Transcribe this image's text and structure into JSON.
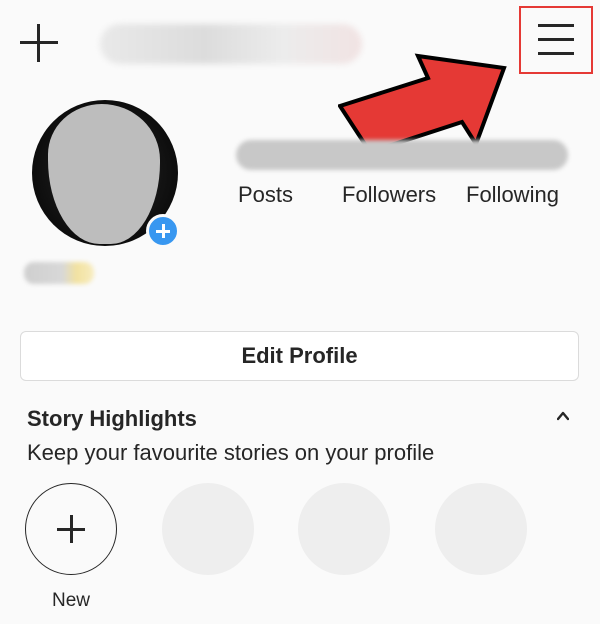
{
  "profile": {
    "stats": {
      "posts_label": "Posts",
      "followers_label": "Followers",
      "following_label": "Following"
    },
    "edit_profile_label": "Edit Profile"
  },
  "highlights": {
    "title": "Story Highlights",
    "subtitle": "Keep your favourite stories on your profile",
    "new_label": "New"
  },
  "colors": {
    "accent_blue": "#3897f0",
    "annotation_red": "#e53935"
  },
  "icons": [
    "add-icon",
    "menu-icon",
    "annotation-arrow-icon",
    "add-story-icon",
    "chevron-up-icon",
    "plus-icon"
  ]
}
